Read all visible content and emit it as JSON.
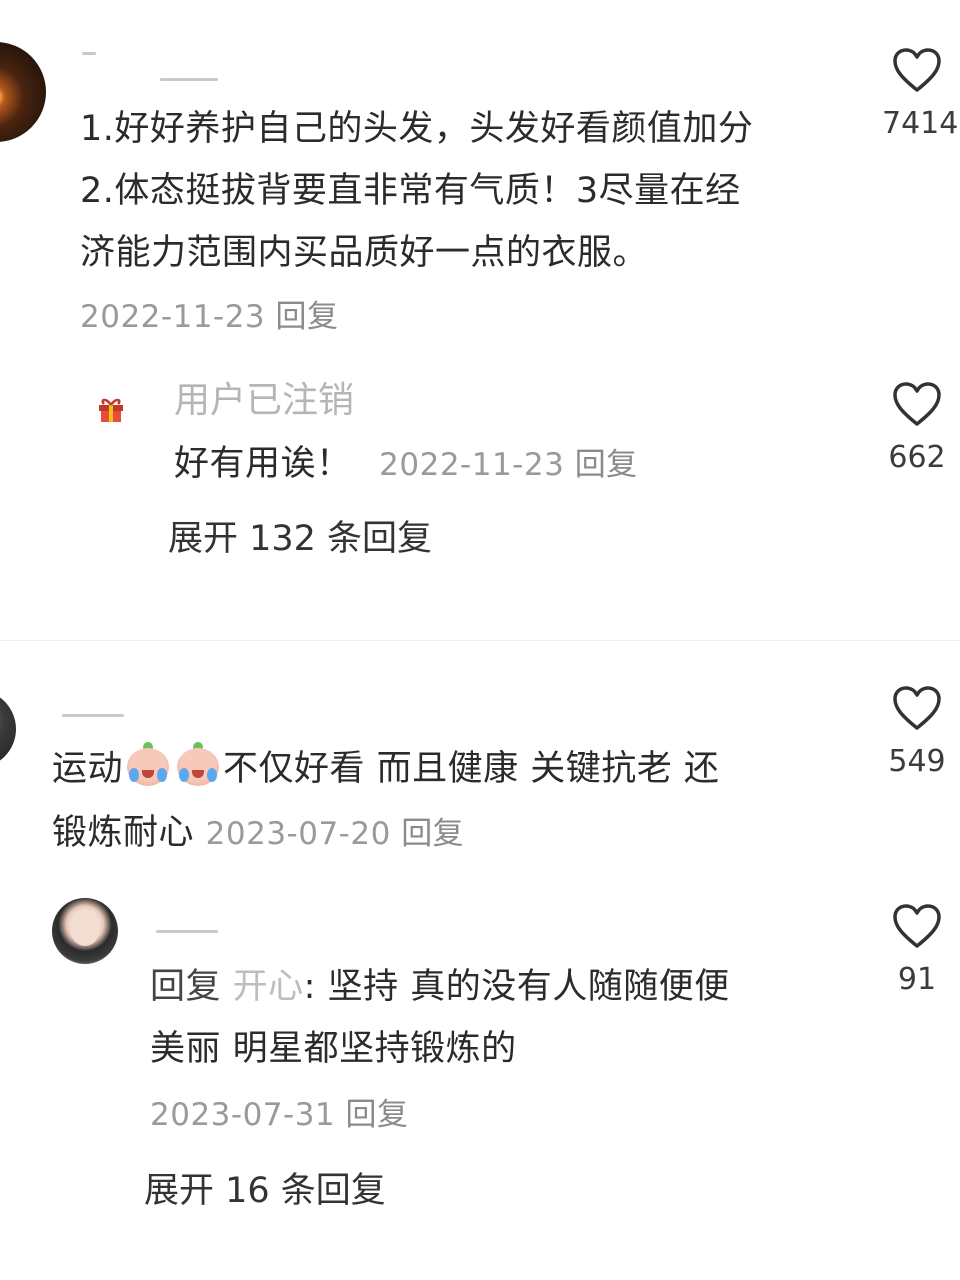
{
  "comments": [
    {
      "text_lines": [
        "1.好好养护自己的头发，头发好看颜值加分",
        "2.体态挺拔背要直非常有气质！3尽量在经",
        "济能力范围内买品质好一点的衣服。"
      ],
      "date": "2022-11-23",
      "reply_label": "回复",
      "likes": "7414",
      "replies": [
        {
          "username": "用户已注销",
          "text": "好有用诶！",
          "date": "2022-11-23",
          "reply_label": "回复",
          "likes": "662"
        }
      ],
      "expand_label": "展开 132 条回复"
    },
    {
      "text_line1_before": "运动",
      "emoji": [
        "crying-face-emoji",
        "crying-face-emoji"
      ],
      "text_line1_after": "不仅好看 而且健康 关键抗老 还",
      "text_line2": "锻炼耐心",
      "date": "2023-07-20",
      "reply_label": "回复",
      "likes": "549",
      "replies": [
        {
          "reply_prefix": "回复",
          "reply_target": "开心",
          "text_line1": ": 坚持 真的没有人随随便便",
          "text_line2": "美丽 明星都坚持锻炼的",
          "date": "2023-07-31",
          "reply_label": "回复",
          "likes": "91"
        }
      ],
      "expand_label": "展开 16 条回复"
    }
  ],
  "colors": {
    "text": "#2b2b2b",
    "meta": "#9a9a9a",
    "muted_username": "#b5b5b5",
    "heart_stroke": "#333333"
  }
}
